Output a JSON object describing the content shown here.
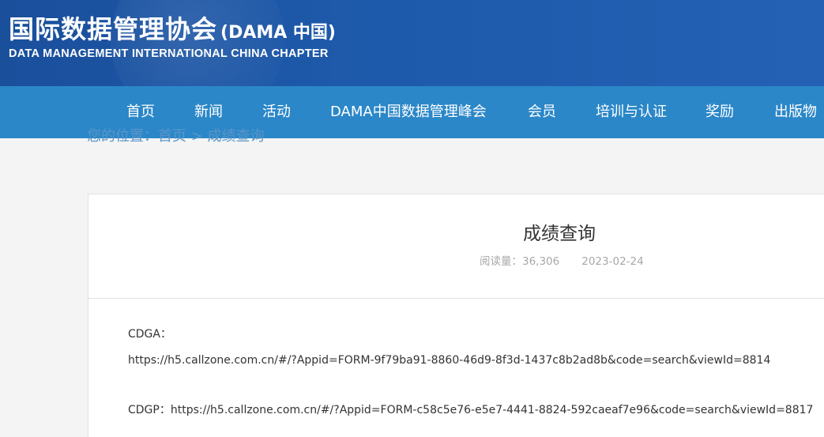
{
  "header": {
    "title_cn": "国际数据管理协会",
    "title_tag": "(DAMA 中国)",
    "subtitle": "DATA MANAGEMENT INTERNATIONAL CHINA CHAPTER"
  },
  "nav": {
    "items": [
      {
        "label": "首页"
      },
      {
        "label": "新闻"
      },
      {
        "label": "活动"
      },
      {
        "label": "DAMA中国数据管理峰会"
      },
      {
        "label": "会员"
      },
      {
        "label": "培训与认证"
      },
      {
        "label": "奖励"
      },
      {
        "label": "出版物"
      }
    ]
  },
  "breadcrumb": {
    "text": "您的位置：首页 > 成绩查询"
  },
  "article": {
    "title": "成绩查询",
    "read_label": "阅读量：",
    "read_count": "36,306",
    "date": "2023-02-24",
    "cdga_label": "CDGA：",
    "cdga_link": "https://h5.callzone.com.cn/#/?Appid=FORM-9f79ba91-8860-46d9-8f3d-1437c8b2ad8b&code=search&viewId=8814",
    "cdgp_label": "CDGP：",
    "cdgp_link": "https://h5.callzone.com.cn/#/?Appid=FORM-c58c5e76-e5e7-4441-8824-592caeaf7e96&code=search&viewId=8817"
  }
}
